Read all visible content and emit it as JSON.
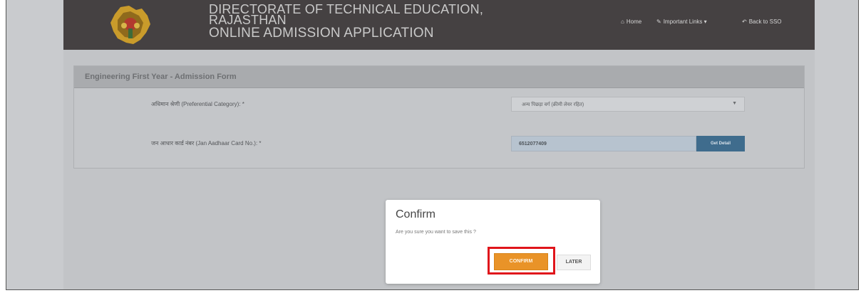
{
  "header": {
    "title_line1": "DIRECTORATE OF TECHNICAL EDUCATION,",
    "title_line2": "RAJASTHAN",
    "title_line3": "ONLINE ADMISSION APPLICATION",
    "nav": {
      "home": "Home",
      "important_links": "Important Links ▾",
      "back_to_sso": "Back to SSO"
    }
  },
  "form": {
    "panel_title": "Engineering First Year - Admission Form",
    "preferential_category_label": "अधिमान श्रेणी (Preferential Category): *",
    "preferential_category_value": "अन्य पिछड़ा वर्ग (क्रीमी लेयर रहित)",
    "jan_aadhaar_label": "जन आधार कार्ड नंबर (Jan Aadhaar Card No.): *",
    "jan_aadhaar_value": "6512077409",
    "get_detail_button": "Get Detail"
  },
  "dialog": {
    "title": "Confirm",
    "message": "Are you sure you want to save this ?",
    "confirm_button": "CONFIRM",
    "later_button": "LATER"
  },
  "colors": {
    "header_bg": "#454142",
    "confirm_orange": "#e99328",
    "highlight_red": "#e0151b",
    "get_detail_blue": "#3f6c8d"
  },
  "icons": {
    "home": "home-icon",
    "links": "link-icon",
    "back": "reply-icon",
    "select_caret": "chevron-down-icon"
  }
}
